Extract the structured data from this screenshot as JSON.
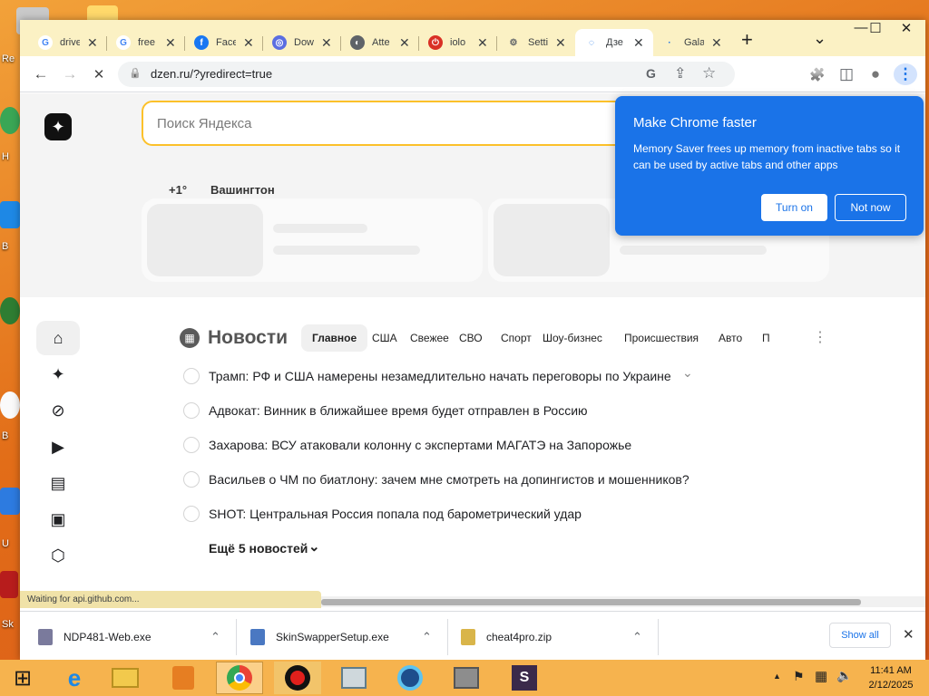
{
  "desktop": {
    "labels": [
      "Re",
      "H",
      "B",
      "B",
      "U",
      "Sk"
    ]
  },
  "window": {
    "controls": {
      "minimize": "—",
      "maximize": "☐",
      "close": "✕"
    }
  },
  "tabs": [
    {
      "title": "drive",
      "fav": "G",
      "favColor": "#4285f4",
      "favBg": "#ffffff"
    },
    {
      "title": "free",
      "fav": "G",
      "favColor": "#4285f4",
      "favBg": "#ffffff"
    },
    {
      "title": "Face",
      "fav": "f",
      "favColor": "#ffffff",
      "favBg": "#1877f2"
    },
    {
      "title": "Dow",
      "fav": "◎",
      "favColor": "#ffffff",
      "favBg": "#5b6ee1"
    },
    {
      "title": "Atte",
      "fav": "◐",
      "favColor": "#ffffff",
      "favBg": "#5f6368"
    },
    {
      "title": "iolo",
      "fav": "⏻",
      "favColor": "#ffffff",
      "favBg": "#d93025"
    },
    {
      "title": "Setti",
      "fav": "⚙",
      "favColor": "#5f6368",
      "favBg": "transparent"
    },
    {
      "title": "Дзе",
      "fav": "◌",
      "favColor": "#1a73e8",
      "favBg": "transparent"
    },
    {
      "title": "Gala",
      "fav": "·",
      "favColor": "#1a73e8",
      "favBg": "transparent"
    }
  ],
  "tabbar": {
    "new_tab": "+",
    "tab_search": "⌄",
    "close_glyph": "✕"
  },
  "toolbar": {
    "back": "←",
    "forward": "→",
    "reload": "✕",
    "url": "dzen.ru/?yredirect=true",
    "lock": "🔒",
    "google": "G",
    "share": "⇪",
    "bookmark": "☆",
    "extensions": "🧩",
    "sidepanel": "◫",
    "profile": "●",
    "menu": "⋮"
  },
  "search": {
    "placeholder": "Поиск Яндекса"
  },
  "weather": {
    "temp": "+1°",
    "city": "Вашингтон"
  },
  "news": {
    "title": "Новости",
    "tabs": [
      "Главное",
      "США",
      "Свежее",
      "СВО",
      "Спорт",
      "Шоу-бизнес",
      "Происшествия",
      "Авто",
      "П"
    ],
    "more_glyph": "⋮",
    "items": [
      "Трамп: РФ и США намерены незамедлительно начать переговоры по Украине",
      "Адвокат: Винник в ближайшее время будет отправлен в Россию",
      "Захарова: ВСУ атаковали колонну с экспертами МАГАТЭ на Запорожье",
      "Васильев о ЧМ по биатлону: зачем мне смотреть на допингистов и мошенников?",
      "SHOT: Центральная Россия попала под барометрический удар"
    ],
    "expand_glyph": "⌄",
    "more_label": "Ещё 5 новостей",
    "more_chevron": "⌄"
  },
  "popup": {
    "title": "Make Chrome faster",
    "desc": "Memory Saver frees up memory from inactive tabs so it can be used by active tabs and other apps",
    "turn_on": "Turn on",
    "not_now": "Not now"
  },
  "status": {
    "text": "Waiting for api.github.com..."
  },
  "downloads": {
    "items": [
      "NDP481-Web.exe",
      "SkinSwapperSetup.exe",
      "cheat4pro.zip"
    ],
    "chevron": "⌃",
    "show_all": "Show all",
    "close": "✕"
  },
  "taskbar": {
    "time": "11:41 AM",
    "date": "2/12/2025",
    "tray": {
      "up": "▲",
      "flag": "⚑",
      "network": "▦",
      "volume": "🔈"
    }
  },
  "colors": {
    "accent": "#1a73e8",
    "search_border": "#fcc12a",
    "tabbar": "#fbf1c4"
  }
}
